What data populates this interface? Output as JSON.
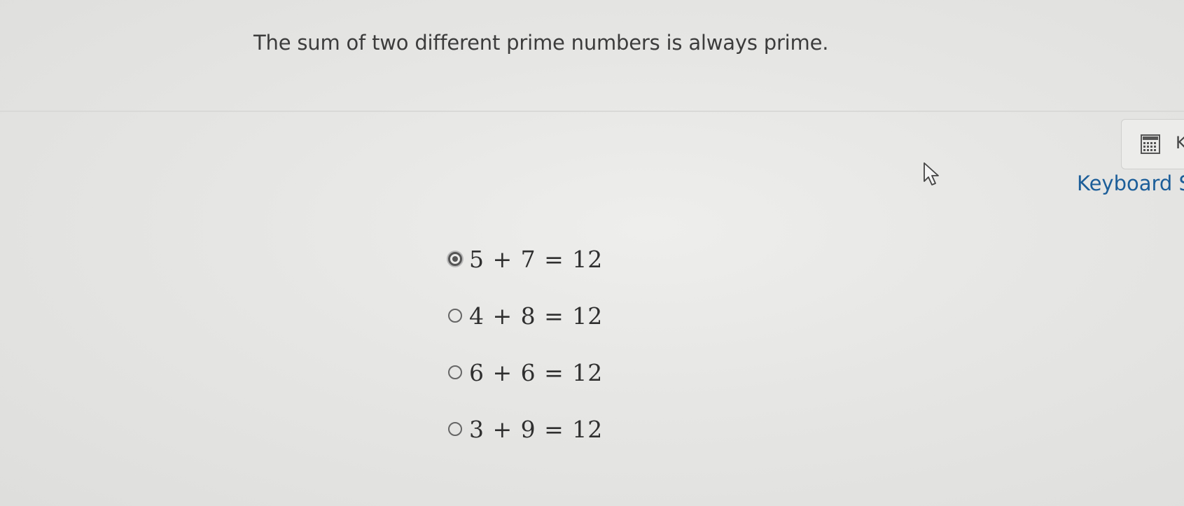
{
  "question": {
    "text": "The sum of two different prime numbers is always prime."
  },
  "sidebar": {
    "tool_letter": "K",
    "keyboard_link": "Keyboard S"
  },
  "options": [
    {
      "label": "5 + 7 = 12",
      "selected": true
    },
    {
      "label": "4 + 8 = 12",
      "selected": false
    },
    {
      "label": "6 + 6 = 12",
      "selected": false
    },
    {
      "label": "3 + 9 = 12",
      "selected": false
    }
  ],
  "colors": {
    "link": "#1c5e99",
    "text": "#3c3c3c",
    "background": "#e6e6e4"
  }
}
